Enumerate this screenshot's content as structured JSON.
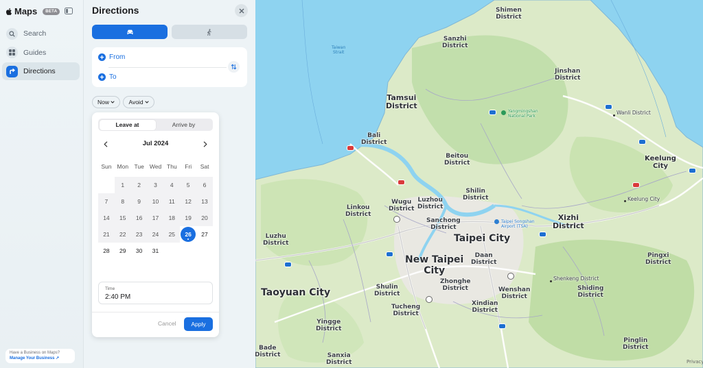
{
  "app": {
    "name": "Maps",
    "badge": "BETA"
  },
  "nav": [
    {
      "label": "Search",
      "icon": "search-icon"
    },
    {
      "label": "Guides",
      "icon": "grid-icon"
    },
    {
      "label": "Directions",
      "icon": "directions-icon",
      "active": true
    }
  ],
  "business": {
    "title": "Have a Business on Maps?",
    "link": "Manage Your Business ↗"
  },
  "directions": {
    "title": "Directions",
    "modes": [
      {
        "name": "drive",
        "icon": "car-icon",
        "selected": true
      },
      {
        "name": "walk",
        "icon": "walk-icon",
        "selected": false
      }
    ],
    "from_label": "From",
    "to_label": "To",
    "time_option": "Now",
    "avoid_option": "Avoid"
  },
  "picker": {
    "segments": [
      "Leave at",
      "Arrive by"
    ],
    "selected_segment": "Leave at",
    "month": "Jul 2024",
    "weekdays": [
      "Sun",
      "Mon",
      "Tue",
      "Wed",
      "Thu",
      "Fri",
      "Sat"
    ],
    "first_weekday_index": 1,
    "days_in_month": 31,
    "selected_day": 26,
    "time_label": "Time",
    "time_value": "2:40 PM",
    "cancel_label": "Cancel",
    "apply_label": "Apply"
  },
  "map": {
    "places": [
      {
        "name": "Shimen\nDistrict"
      },
      {
        "name": "Sanzhi\nDistrict"
      },
      {
        "name": "Jinshan\nDistrict"
      },
      {
        "name": "Tamsui\nDistrict"
      },
      {
        "name": "Wanli District"
      },
      {
        "name": "Bali\nDistrict"
      },
      {
        "name": "Beitou\nDistrict"
      },
      {
        "name": "Keelung\nCity"
      },
      {
        "name": "Shilin\nDistrict"
      },
      {
        "name": "Keelung City"
      },
      {
        "name": "Wugu\nDistrict"
      },
      {
        "name": "Luzhou\nDistrict"
      },
      {
        "name": "Linkou\nDistrict"
      },
      {
        "name": "Sanchong\nDistrict"
      },
      {
        "name": "Xizhi\nDistrict"
      },
      {
        "name": "Taipei City"
      },
      {
        "name": "Luzhu\nDistrict"
      },
      {
        "name": "New Taipei\nCity"
      },
      {
        "name": "Daan\nDistrict"
      },
      {
        "name": "Pingxi\nDistrict"
      },
      {
        "name": "Shenkeng District"
      },
      {
        "name": "Taoyuan City"
      },
      {
        "name": "Shulin\nDistrict"
      },
      {
        "name": "Zhonghe\nDistrict"
      },
      {
        "name": "Wenshan\nDistrict"
      },
      {
        "name": "Shiding\nDistrict"
      },
      {
        "name": "Xindian\nDistrict"
      },
      {
        "name": "Tucheng\nDistrict"
      },
      {
        "name": "Yingge\nDistrict"
      },
      {
        "name": "Pinglin\nDistrict"
      },
      {
        "name": "Bade\nDistrict"
      },
      {
        "name": "Sanxia\nDistrict"
      }
    ],
    "park_label": "Yangmingshan\nNational Park",
    "airport_label": "Taipei Songshan\nAirport (TSA)",
    "water_label": "Taiwan\nStrait",
    "privacy_label": "Privacy"
  }
}
